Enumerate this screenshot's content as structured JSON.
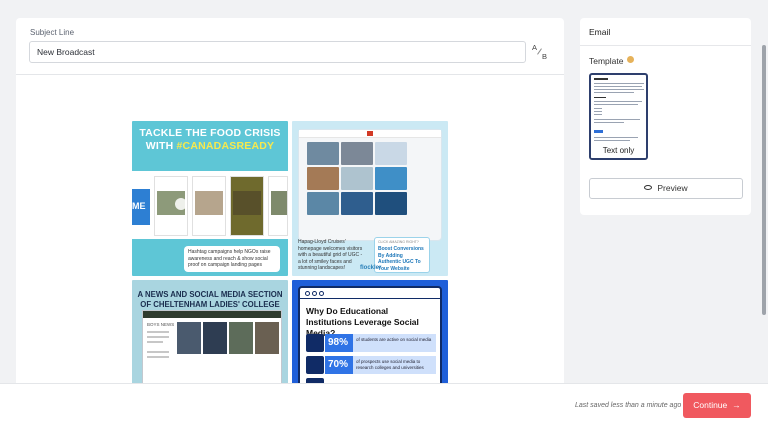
{
  "subject": {
    "label": "Subject Line",
    "value": "New Broadcast",
    "ab_a": "A",
    "ab_b": "B"
  },
  "preview_tiles": {
    "tile1": {
      "title_line1": "TACKLE THE FOOD CRISIS",
      "title_prefix": "WITH ",
      "hashtag": "#CANADASREADY",
      "side_label": "ME",
      "bubble_text": "Hashtag campaigns help NGOs raise awareness and reach & show social proof on campaign landing pages"
    },
    "tile2": {
      "body_text": "Hapag-Lloyd Cruises' homepage welcomes visitors with a beautiful grid of UGC - a lot of smiley faces and stunning landscapes!",
      "cta_small": "CLICK AMAZING RIGHT?",
      "cta_big": "Boost Conversions By Adding Authentic UGC To Your Website",
      "logo": "flockler"
    },
    "tile3": {
      "title": "A NEWS AND SOCIAL MEDIA SECTION OF CHELTENHAM LADIES' COLLEGE",
      "site_label": "BOYS NEWS"
    },
    "tile4": {
      "title": "Why Do Educational Institutions Leverage Social Media?",
      "stat1_value": "98%",
      "stat1_text": "of students are active on social media",
      "stat2_value": "70%",
      "stat2_text": "of prospects use social media to research colleges and universities"
    }
  },
  "email_panel": {
    "title": "Email",
    "template_label": "Template",
    "template_caption": "Text only",
    "preview_button": "Preview"
  },
  "footer": {
    "saved_text": "Last saved less than a minute ago",
    "continue_label": "Continue",
    "continue_arrow": "→"
  },
  "colors": {
    "accent": "#f0595f",
    "info_dot": "#e6b25a",
    "template_border": "#2e3f6d"
  }
}
